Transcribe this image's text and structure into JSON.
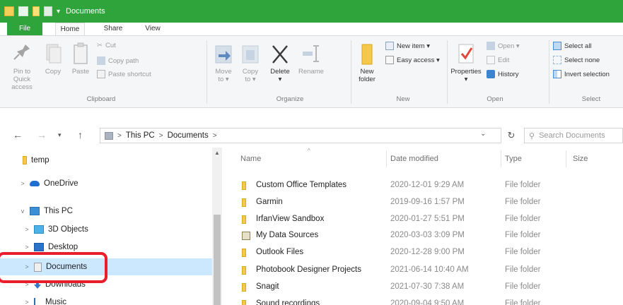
{
  "window": {
    "title": "Documents"
  },
  "ribbon_tabs": [
    "File",
    "Home",
    "Share",
    "View"
  ],
  "ribbon": {
    "clipboard": {
      "label": "Clipboard",
      "pin_line1": "Pin to Quick",
      "pin_line2": "access",
      "copy": "Copy",
      "paste": "Paste",
      "cut": "Cut",
      "copy_path": "Copy path",
      "paste_shortcut": "Paste shortcut"
    },
    "organize": {
      "label": "Organize",
      "move_to_line1": "Move",
      "move_to_line2": "to ▾",
      "copy_to_line1": "Copy",
      "copy_to_line2": "to ▾",
      "delete": "Delete",
      "delete_arrow": "▾",
      "rename": "Rename"
    },
    "new": {
      "label": "New",
      "new_folder_line1": "New",
      "new_folder_line2": "folder",
      "new_item": "New item ▾",
      "easy_access": "Easy access ▾"
    },
    "open": {
      "label": "Open",
      "properties": "Properties",
      "properties_arrow": "▾",
      "open": "Open ▾",
      "edit": "Edit",
      "history": "History"
    },
    "select": {
      "label": "Select",
      "select_all": "Select all",
      "select_none": "Select none",
      "invert_selection": "Invert selection"
    }
  },
  "address": {
    "path": [
      "This PC",
      "Documents"
    ],
    "sep": ">",
    "search_placeholder": "Search Documents"
  },
  "nav": {
    "items": [
      {
        "label": "temp",
        "chev": "",
        "icon": "folder-icon"
      },
      {
        "label": "OneDrive",
        "chev": ">",
        "icon": "onedrive-icon"
      },
      {
        "label": "This PC",
        "chev": "v",
        "icon": "this-pc-icon"
      },
      {
        "label": "3D Objects",
        "chev": ">",
        "icon": "3d-objects-icon"
      },
      {
        "label": "Desktop",
        "chev": ">",
        "icon": "desktop-icon"
      },
      {
        "label": "Documents",
        "chev": ">",
        "icon": "documents-icon"
      },
      {
        "label": "Downloads",
        "chev": ">",
        "icon": "downloads-icon"
      },
      {
        "label": "Music",
        "chev": ">",
        "icon": "music-icon"
      }
    ]
  },
  "columns": {
    "name": "Name",
    "date": "Date modified",
    "type": "Type",
    "size": "Size"
  },
  "files": [
    {
      "name": "Custom Office Templates",
      "date": "2020-12-01 9:29 AM",
      "type": "File folder"
    },
    {
      "name": "Garmin",
      "date": "2019-09-16 1:57 PM",
      "type": "File folder"
    },
    {
      "name": "IrfanView Sandbox",
      "date": "2020-01-27 5:51 PM",
      "type": "File folder"
    },
    {
      "name": "My Data Sources",
      "date": "2020-03-03 3:09 PM",
      "type": "File folder"
    },
    {
      "name": "Outlook Files",
      "date": "2020-12-28 9:00 PM",
      "type": "File folder"
    },
    {
      "name": "Photobook Designer Projects",
      "date": "2021-06-14 10:40 AM",
      "type": "File folder"
    },
    {
      "name": "Snagit",
      "date": "2021-07-30 7:38 AM",
      "type": "File folder"
    },
    {
      "name": "Sound recordings",
      "date": "2020-09-04 9:50 AM",
      "type": "File folder"
    }
  ],
  "colors": {
    "titlebar": "#2fa43a",
    "selection": "#cce8ff",
    "highlight": "#ea1d2c",
    "folder": "#f3c84b"
  }
}
